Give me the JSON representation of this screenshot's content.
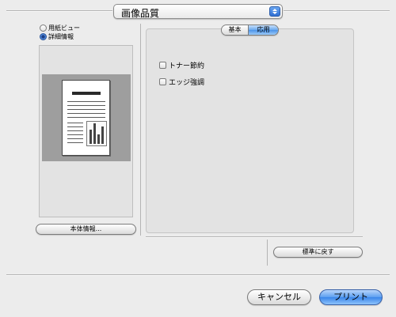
{
  "popup": {
    "value": "画像品質"
  },
  "view": {
    "options": [
      {
        "label": "用紙ビュー",
        "selected": false
      },
      {
        "label": "詳細情報",
        "selected": true
      }
    ]
  },
  "left": {
    "button_label": "本体情報..."
  },
  "tabs": {
    "basic": "基本",
    "advanced": "応用",
    "selected": "応用"
  },
  "options": {
    "toner_save": {
      "label": "トナー節約",
      "checked": false
    },
    "edge_enhance": {
      "label": "エッジ強調",
      "checked": false
    }
  },
  "reset_button": "標準に戻す",
  "footer": {
    "cancel": "キャンセル",
    "print": "プリント"
  },
  "colors": {
    "accent": "#3a86ea",
    "background": "#ececec",
    "panel": "#e3e3e3"
  }
}
